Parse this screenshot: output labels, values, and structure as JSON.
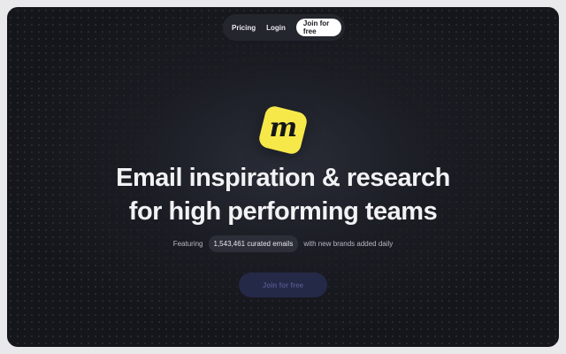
{
  "nav": {
    "links": [
      {
        "label": "Pricing"
      },
      {
        "label": "Login"
      }
    ],
    "cta_label": "Join for free"
  },
  "logo": {
    "letter": "m",
    "color": "#f7e84a",
    "icon": "brand-logo-icon"
  },
  "hero": {
    "headline_line1": "Email inspiration & research",
    "headline_line2": "for high performing teams",
    "featuring_prefix": "Featuring",
    "count_badge": "1,543,461 curated emails",
    "featuring_suffix": "with new brands added daily",
    "cta_label": "Join for free"
  },
  "colors": {
    "background": "#15161b",
    "accent": "#f7e84a",
    "cta_bg": "#252948"
  }
}
